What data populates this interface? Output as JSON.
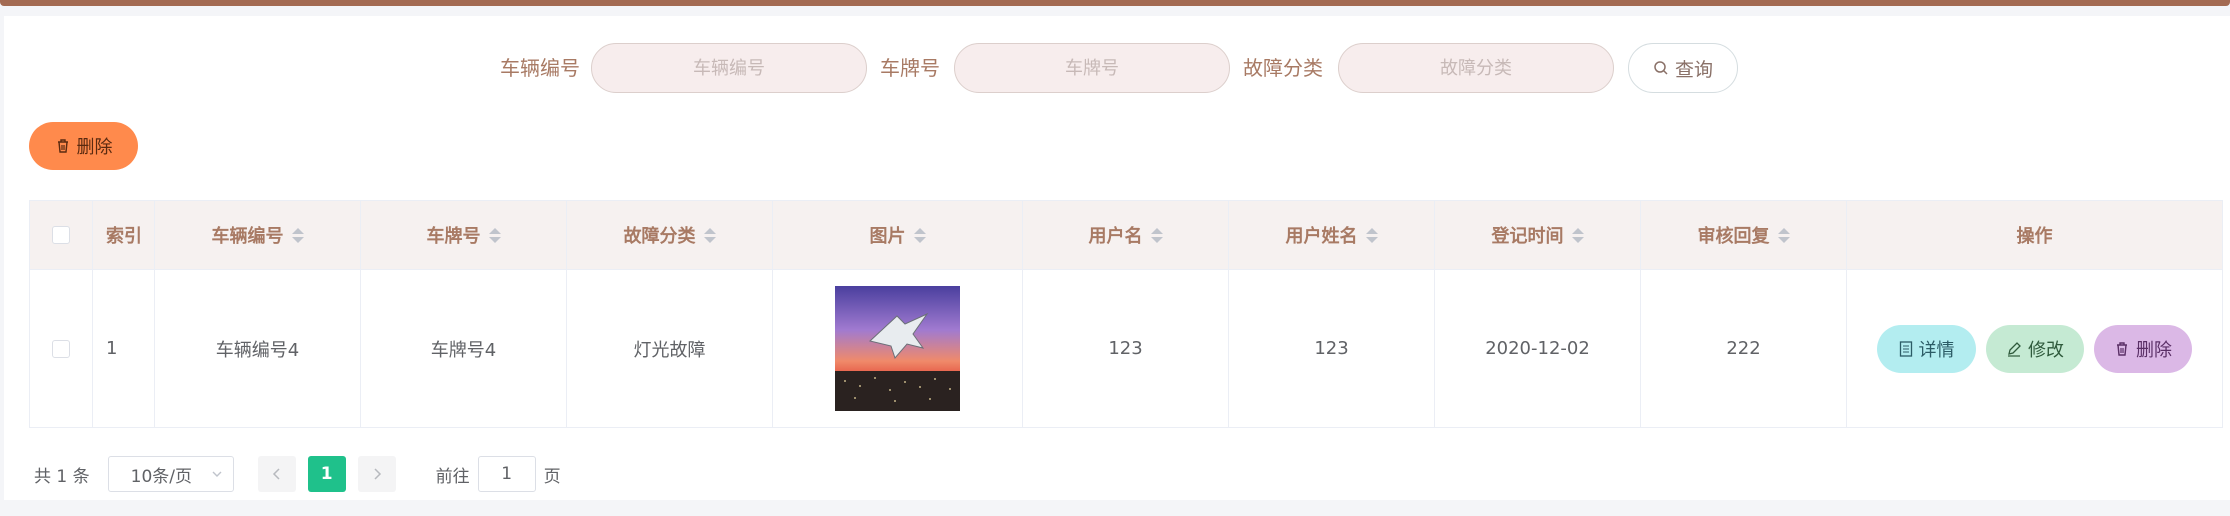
{
  "search": {
    "vehicle_no_label": "车辆编号",
    "vehicle_no_placeholder": "车辆编号",
    "plate_label": "车牌号",
    "plate_placeholder": "车牌号",
    "fault_label": "故障分类",
    "fault_placeholder": "故障分类",
    "query_label": "查询"
  },
  "toolbar": {
    "delete_label": "删除"
  },
  "table": {
    "headers": {
      "index": "索引",
      "vehicle_no": "车辆编号",
      "plate": "车牌号",
      "fault": "故障分类",
      "image": "图片",
      "username": "用户名",
      "user_fullname": "用户姓名",
      "reg_time": "登记时间",
      "review_reply": "审核回复",
      "ops": "操作"
    },
    "rows": [
      {
        "index": "1",
        "vehicle_no": "车辆编号4",
        "plate": "车牌号4",
        "fault": "灯光故障",
        "username": "123",
        "user_fullname": "123",
        "reg_time": "2020-12-02",
        "review_reply": "222",
        "detail_label": "详情",
        "edit_label": "修改",
        "delete_label": "删除"
      }
    ]
  },
  "pager": {
    "total": "共 1 条",
    "page_size": "10条/页",
    "current_page": "1",
    "goto_label": "前往",
    "goto_value": "1",
    "page_suffix": "页"
  },
  "colors": {
    "top_bar": "#a36a52",
    "delete_btn": "#ff8a4c",
    "detail_btn": "#b3edf0",
    "edit_btn": "#c5ead3",
    "row_delete_btn": "#dbb8e6",
    "active_page": "#1fc18b"
  }
}
